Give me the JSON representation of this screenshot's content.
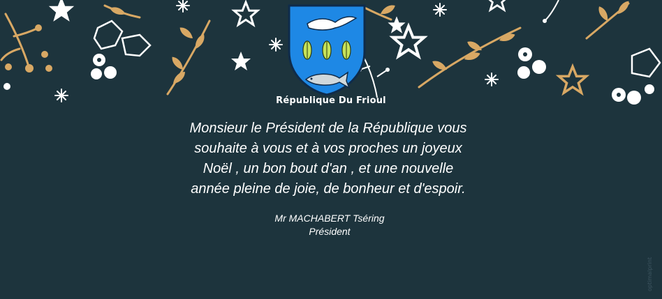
{
  "card": {
    "background_color": "#1d343d",
    "accent_gold": "#d8a864",
    "accent_white": "#ffffff",
    "crest": {
      "shield_color": "#1e88e5",
      "icons": [
        "seagull-icon",
        "cicada-icon",
        "cicada-icon",
        "cicada-icon",
        "fish-icon"
      ]
    },
    "republic_name": "République Du Frioul",
    "message_lines": [
      "Monsieur le Président de la République vous",
      "souhaite à vous et à vos proches un joyeux",
      "Noël , un bon bout d'an , et une nouvelle",
      "année pleine de joie, de bonheur et d'espoir."
    ],
    "signature": {
      "name": "Mr MACHABERT Tséring",
      "title": "Président"
    },
    "watermark": "optimalprint"
  }
}
